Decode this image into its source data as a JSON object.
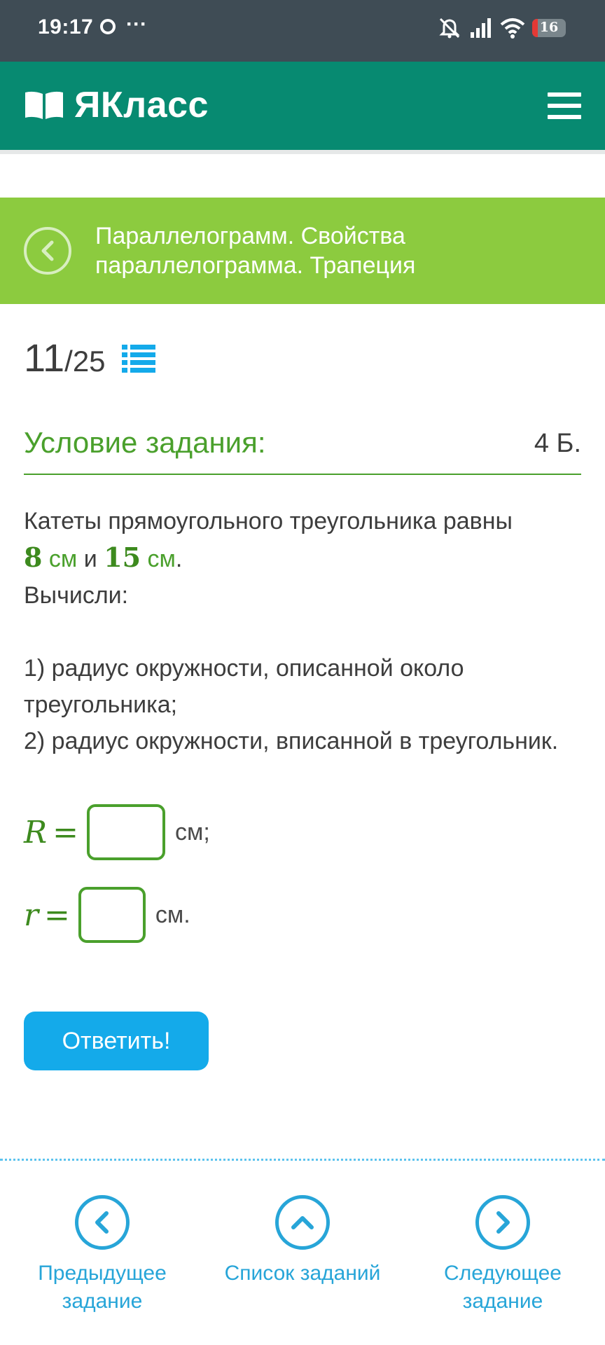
{
  "status_bar": {
    "time": "19:17",
    "dots": "···",
    "battery": "16",
    "battery_level_percent": 16,
    "icons": [
      "chat-bubble-icon",
      "mute-icon",
      "signal-icon",
      "wifi-icon",
      "battery-icon"
    ]
  },
  "header": {
    "logo_text": "ЯКласс",
    "icons": [
      "book-logo-icon",
      "hamburger-menu-icon"
    ]
  },
  "topic": {
    "title": "Параллелограмм. Свойства параллелограмма. Трапеция",
    "back_icon": "chevron-left-icon"
  },
  "progress": {
    "current": "11",
    "separator": "/",
    "total": "25",
    "list_icon": "task-list-icon"
  },
  "condition": {
    "title": "Условие задания:",
    "points": "4 Б."
  },
  "task": {
    "line1_text": "Катеты прямоугольного треугольника равны",
    "leg1": "8",
    "unit1": "см",
    "conj": "и",
    "leg2": "15",
    "unit2": "см",
    "period": ".",
    "compute": "Вычисли:",
    "item1": "1) радиус окружности, описанной около треугольника;",
    "item2": "2) радиус окружности, вписанной в треугольник."
  },
  "answers": [
    {
      "variable": "R",
      "equals": "=",
      "value": "",
      "unit": "см;"
    },
    {
      "variable": "r",
      "equals": "=",
      "value": "",
      "unit": "см."
    }
  ],
  "submit_label": "Ответить!",
  "colors": {
    "status_bar": "#3f4c55",
    "header": "#078a71",
    "topic_bar": "#8ccb3f",
    "accent_green": "#4aa02c",
    "button_blue": "#14aaea",
    "nav_blue": "#27a5d8"
  },
  "bottom_nav": {
    "prev_line1": "Предыдущее",
    "prev_line2": "задание",
    "list": "Список заданий",
    "next_line1": "Следующее",
    "next_line2": "задание",
    "icons": [
      "chevron-left-icon",
      "chevron-up-icon",
      "chevron-right-icon"
    ]
  }
}
